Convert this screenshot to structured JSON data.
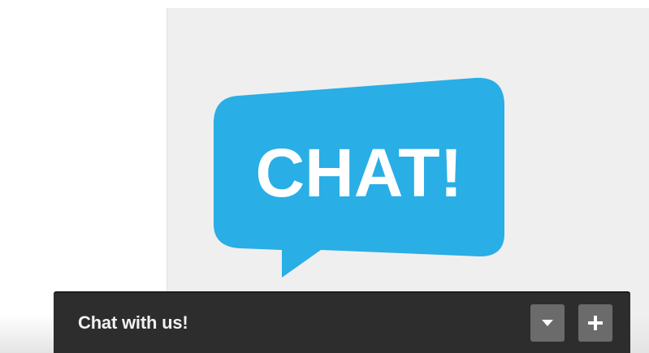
{
  "logo": {
    "text": "CHAT!",
    "bubble_color": "#29aee6",
    "text_color": "#ffffff"
  },
  "chat_bar": {
    "title": "Chat with us!",
    "minimize_icon": "caret-down-icon",
    "expand_icon": "plus-icon",
    "bar_color": "#2d2d2d",
    "button_color": "#6b6b6b"
  }
}
